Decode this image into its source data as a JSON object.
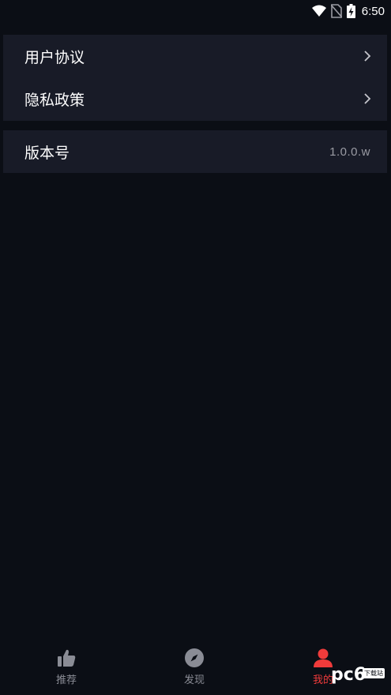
{
  "status_bar": {
    "time": "6:50",
    "icons": [
      "wifi-icon",
      "no-sim-icon",
      "battery-charging-icon"
    ]
  },
  "settings": {
    "links": [
      {
        "label": "用户协议",
        "icon": "chevron-right-icon"
      },
      {
        "label": "隐私政策",
        "icon": "chevron-right-icon"
      }
    ],
    "version": {
      "label": "版本号",
      "value": "1.0.0.w"
    }
  },
  "bottom_nav": {
    "items": [
      {
        "label": "推荐",
        "icon": "thumbs-up-icon",
        "active": false
      },
      {
        "label": "发现",
        "icon": "compass-icon",
        "active": false
      },
      {
        "label": "我的",
        "icon": "user-icon",
        "active": true
      }
    ]
  },
  "watermark": {
    "text": "pc6",
    "sub": "下载站"
  },
  "colors": {
    "background": "#0b0e15",
    "card": "#181b27",
    "text": "#ffffff",
    "muted": "#8a8c95",
    "accent": "#ef3b3b"
  }
}
